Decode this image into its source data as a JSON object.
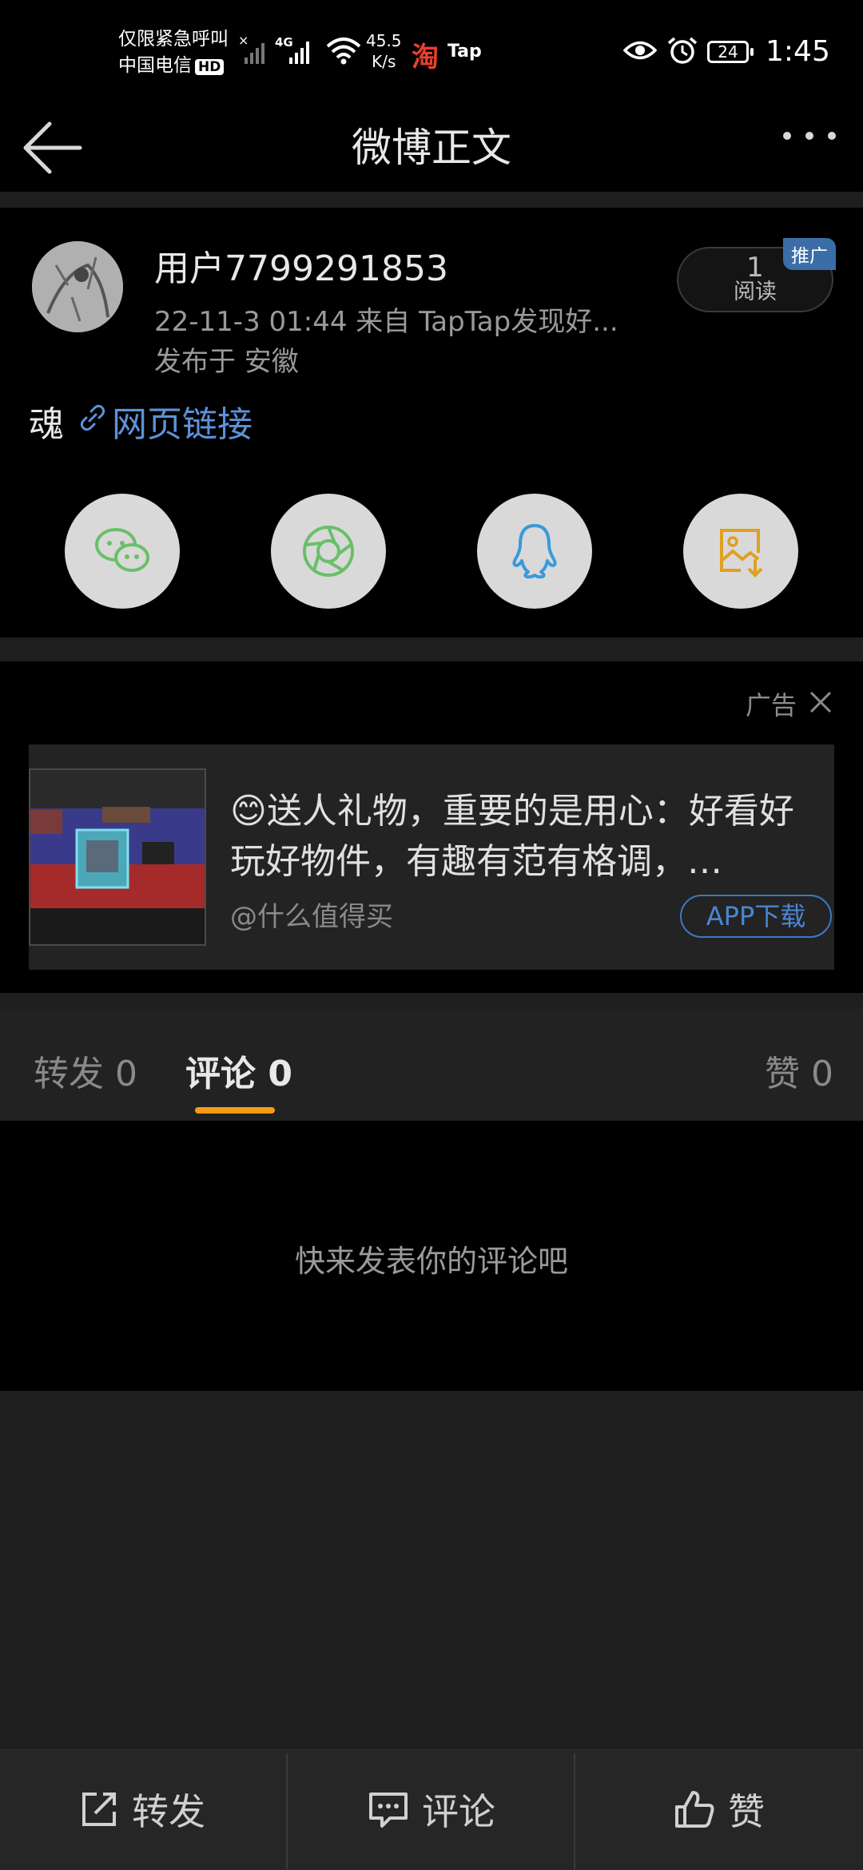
{
  "status_bar": {
    "emergency": "仅限紧急呼叫",
    "carrier": "中国电信",
    "hd": "HD",
    "net_type": "4G",
    "speed_value": "45.5",
    "speed_unit": "K/s",
    "app1": "淘",
    "app2": "Tap",
    "battery": "24",
    "time": "1:45"
  },
  "header": {
    "title": "微博正文",
    "back_icon": "arrow-left-icon",
    "more_icon": "more-dots-icon"
  },
  "post": {
    "username": "用户7799291853",
    "meta": "22-11-3 01:44  来自 TapTap发现好...",
    "location": "发布于 安徽",
    "read_count": "1",
    "read_label": "阅读",
    "promo_badge": "推广",
    "content": "魂",
    "link_text": "网页链接"
  },
  "share_buttons": [
    {
      "name": "wechat",
      "icon": "wechat-icon",
      "color": "#6abf69"
    },
    {
      "name": "moments",
      "icon": "moments-icon",
      "color": "#6abf69"
    },
    {
      "name": "qq",
      "icon": "qq-icon",
      "color": "#3a9ad9"
    },
    {
      "name": "save-image",
      "icon": "save-image-icon",
      "color": "#e0a020"
    }
  ],
  "ad": {
    "label": "广告",
    "emoji": "😊",
    "title": "送人礼物，重要的是用心：好看好玩好物件，有趣有范有格调，…",
    "source": "@什么值得买",
    "button": "APP下载"
  },
  "tabs": {
    "repost": "转发 0",
    "comment": "评论 0",
    "like": "赞 0",
    "active_color": "#f39c12"
  },
  "empty_comments": "快来发表你的评论吧",
  "bottom_bar": {
    "repost": "转发",
    "comment": "评论",
    "like": "赞"
  }
}
